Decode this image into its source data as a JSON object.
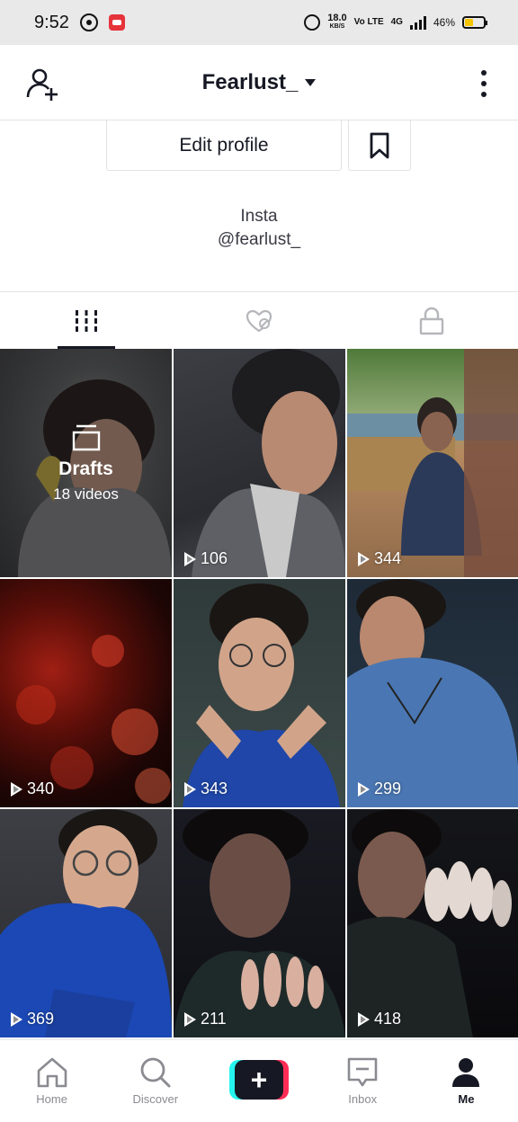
{
  "status_bar": {
    "time": "9:52",
    "speed_value": "18.0",
    "speed_unit": "KB/S",
    "volte": "Vo LTE",
    "network": "4G",
    "battery_pct": "46%"
  },
  "header": {
    "username": "Fearlust_"
  },
  "profile": {
    "edit_label": "Edit profile",
    "bio_line1": "Insta",
    "bio_line2": "@fearlust_"
  },
  "tabs": [
    {
      "name": "videos",
      "active": true
    },
    {
      "name": "liked",
      "active": false
    },
    {
      "name": "private",
      "active": false
    }
  ],
  "drafts": {
    "title": "Drafts",
    "count_label": "18 videos"
  },
  "videos": [
    {
      "views": "106"
    },
    {
      "views": "344"
    },
    {
      "views": "340"
    },
    {
      "views": "343"
    },
    {
      "views": "299"
    },
    {
      "views": "369"
    },
    {
      "views": "211"
    },
    {
      "views": "418"
    }
  ],
  "bottom_nav": {
    "home": "Home",
    "discover": "Discover",
    "inbox": "Inbox",
    "me": "Me"
  },
  "colors": {
    "accent_red": "#fe2c55",
    "accent_cyan": "#25f4ee",
    "text_primary": "#161823",
    "text_secondary": "#8a8b91"
  }
}
